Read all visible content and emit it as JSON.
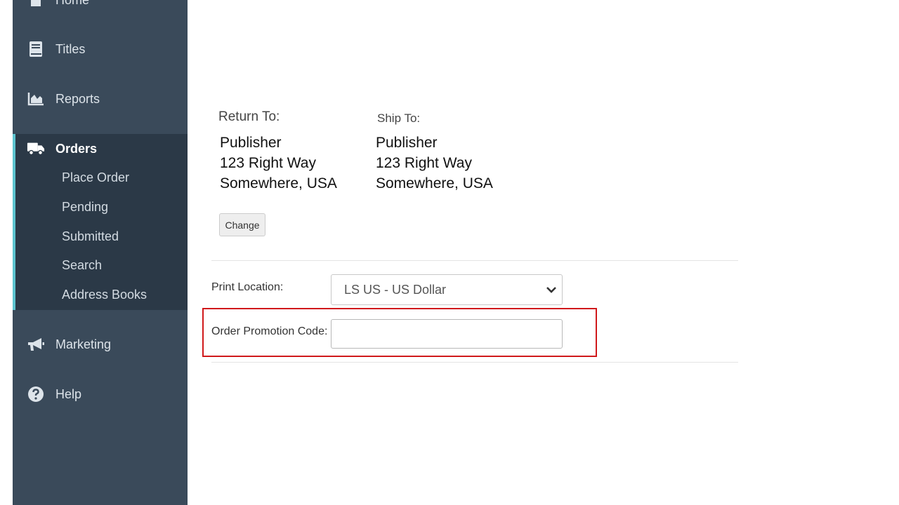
{
  "sidebar": {
    "items": [
      {
        "label": "Home",
        "icon": "home-icon"
      },
      {
        "label": "Titles",
        "icon": "book-icon"
      },
      {
        "label": "Reports",
        "icon": "area-chart-icon"
      },
      {
        "label": "Orders",
        "icon": "truck-icon"
      },
      {
        "label": "Marketing",
        "icon": "megaphone-icon"
      },
      {
        "label": "Help",
        "icon": "question-circle-icon"
      }
    ],
    "orders_subitems": [
      "Place Order",
      "Pending",
      "Submitted",
      "Search",
      "Address Books"
    ]
  },
  "address": {
    "return_to": {
      "heading": "Return To:",
      "name": "Publisher",
      "street": "123 Right Way",
      "city": "Somewhere, USA"
    },
    "ship_to": {
      "heading": "Ship To:",
      "name": "Publisher",
      "street": "123 Right Way",
      "city": "Somewhere, USA"
    },
    "change_label": "Change"
  },
  "form": {
    "print_location_label": "Print Location:",
    "print_location_value": "LS US - US Dollar",
    "promo_label": "Order Promotion Code:",
    "promo_value": ""
  },
  "colors": {
    "sidebar_bg": "#3a4a5a",
    "sidebar_active_bg": "#2b3947",
    "active_accent": "#5cc4cf",
    "highlight_border": "#d0191b"
  }
}
